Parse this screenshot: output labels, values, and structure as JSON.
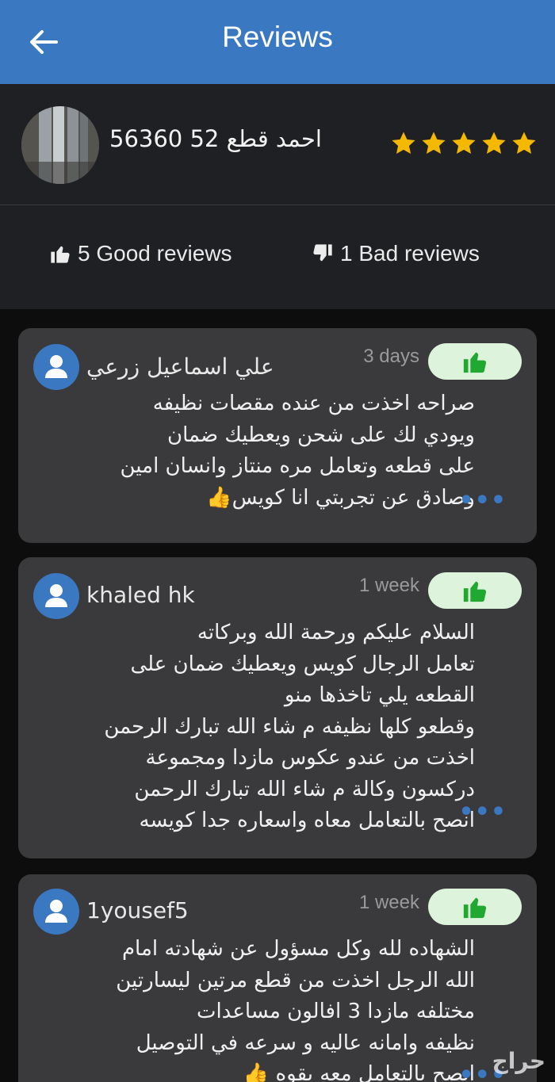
{
  "header": {
    "title": "Reviews",
    "back_icon": "arrow-left-icon"
  },
  "seller": {
    "name": "احمد قطع 52 56360",
    "rating": 5,
    "max_rating": 5,
    "star_color": "#f5b800"
  },
  "summary": {
    "good_label": "5 Good reviews",
    "bad_label": "1 Bad reviews"
  },
  "reviews": [
    {
      "user": "علي اسماعيل زرعي",
      "time": "3 days",
      "vote": "thumbs-up",
      "text": "صراحه اخذت من عنده مقصات نظيفه\nويودي لك على شحن ويعطيك ضمان\nعلى قطعه وتعامل مره منتاز وانسان امين\nوصادق عن تجربتي انا كويس👍",
      "more": "•••"
    },
    {
      "user": "khaled hk",
      "time": "1 week",
      "vote": "thumbs-up",
      "text": "السلام عليكم ورحمة الله وبركاته \nتعامل الرجال كويس ويعطيك ضمان على\nالقطعه يلي تاخذها منو \nوقطعو كلها نظيفه م شاء الله تبارك الرحمن\nاخذت من عندو عكوس مازدا ومجموعة\nدركسون وكالة م شاء الله تبارك الرحمن\nانصح بالتعامل معاه واسعاره جدا  كويسه",
      "more": "•••"
    },
    {
      "user": "1yousef5",
      "time": "1 week",
      "vote": "thumbs-up",
      "text": "الشهاده لله وكل  مسؤول عن شهادته امام\nالله   الرجل اخذت من قطع مرتين ليسارتين\nمختلفه   مازدا 3   افالون   مساعدات\nنظيفه وامانه عاليه و سرعه في التوصيل\nانصح بالتعامل معه بقوه 👍",
      "more": "•••"
    }
  ],
  "watermark": "حراج",
  "colors": {
    "accent": "#3a78c2",
    "like_bg": "#ddf3dc",
    "like_icon": "#21a830"
  }
}
